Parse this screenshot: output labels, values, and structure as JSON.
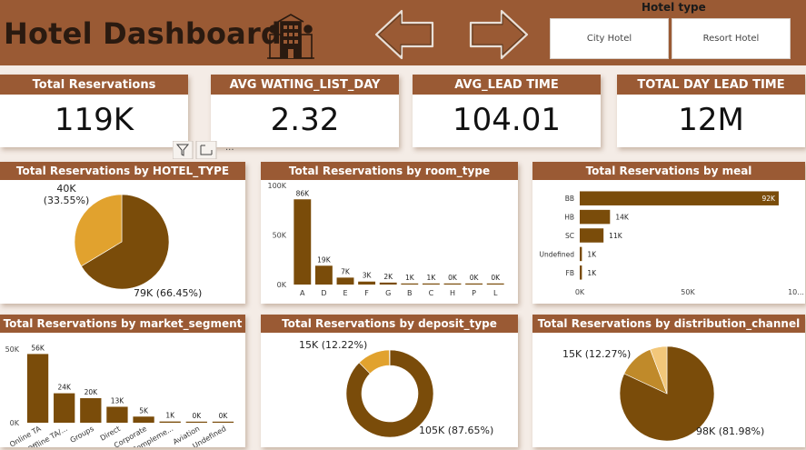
{
  "header": {
    "title": "Hotel Dashboard"
  },
  "icons": {
    "hotel": "hotel-building-icon",
    "back": "arrow-left-icon",
    "forward": "arrow-right-icon",
    "filter": "filter-icon",
    "focus": "focus-mode-icon",
    "more": "more-options-icon"
  },
  "slicer": {
    "title": "Hotel type",
    "options": [
      "City Hotel",
      "Resort Hotel"
    ]
  },
  "kpis": [
    {
      "label": "Total Reservations",
      "value": "119K"
    },
    {
      "label": "AVG WATING_LIST_DAY",
      "value": "2.32"
    },
    {
      "label": "AVG_LEAD TIME",
      "value": "104.01"
    },
    {
      "label": "TOTAL DAY LEAD TIME",
      "value": "12M"
    }
  ],
  "colors": {
    "header": "#9a5a34",
    "dark": "#7a4c0a",
    "gold": "#e1a22e",
    "light": "#f2c77a"
  },
  "chart_data": [
    {
      "type": "pie",
      "title": "Total Reservations by HOTEL_TYPE",
      "slices": [
        {
          "name": "",
          "value": 79,
          "label": "79K (66.45%)",
          "color": "#7a4c0a"
        },
        {
          "name": "",
          "value": 40,
          "label": "40K (33.55%)",
          "color": "#e1a22e"
        }
      ]
    },
    {
      "type": "bar",
      "title": "Total Reservations by room_type",
      "categories": [
        "A",
        "D",
        "E",
        "F",
        "G",
        "B",
        "C",
        "H",
        "P",
        "L"
      ],
      "values": [
        86,
        19,
        7,
        3,
        2,
        1,
        1,
        0,
        0,
        0
      ],
      "data_labels": [
        "86K",
        "19K",
        "7K",
        "3K",
        "2K",
        "1K",
        "1K",
        "0K",
        "0K",
        "0K"
      ],
      "yticks": [
        "0K",
        "50K",
        "100K"
      ],
      "ylim": [
        0,
        100
      ]
    },
    {
      "type": "bar",
      "orientation": "horizontal",
      "title": "Total Reservations by meal",
      "categories": [
        "BB",
        "HB",
        "SC",
        "Undefined",
        "FB"
      ],
      "values": [
        92,
        14,
        11,
        1,
        1
      ],
      "data_labels": [
        "92K",
        "14K",
        "11K",
        "1K",
        "1K"
      ],
      "xticks": [
        "0K",
        "50K",
        "10..."
      ],
      "xlim": [
        0,
        100
      ]
    },
    {
      "type": "bar",
      "title": "Total Reservations by market_segment",
      "categories": [
        "Online TA",
        "Offline TA/...",
        "Groups",
        "Direct",
        "Corporate",
        "Compleme...",
        "Aviation",
        "Undefined"
      ],
      "values": [
        56,
        24,
        20,
        13,
        5,
        1,
        0,
        0
      ],
      "data_labels": [
        "56K",
        "24K",
        "20K",
        "13K",
        "5K",
        "1K",
        "0K",
        "0K"
      ],
      "yticks": [
        "0K",
        "50K"
      ],
      "ylim": [
        0,
        60
      ]
    },
    {
      "type": "pie",
      "subtype": "donut",
      "title": "Total Reservations by deposit_type",
      "slices": [
        {
          "name": "",
          "value": 105,
          "label": "105K (87.65%)",
          "color": "#7a4c0a"
        },
        {
          "name": "",
          "value": 14.7,
          "label": "15K (12.22%)",
          "color": "#e1a22e"
        },
        {
          "name": "",
          "value": 0.16,
          "label": "",
          "color": "#f2c77a"
        }
      ]
    },
    {
      "type": "pie",
      "title": "Total Reservations by distribution_channel",
      "slices": [
        {
          "name": "",
          "value": 98,
          "label": "98K (81.98%)",
          "color": "#7a4c0a"
        },
        {
          "name": "",
          "value": 14.7,
          "label": "15K (12.27%)",
          "color": "#c08a2a"
        },
        {
          "name": "",
          "value": 6.9,
          "label": "",
          "color": "#f2c77a"
        }
      ]
    }
  ]
}
